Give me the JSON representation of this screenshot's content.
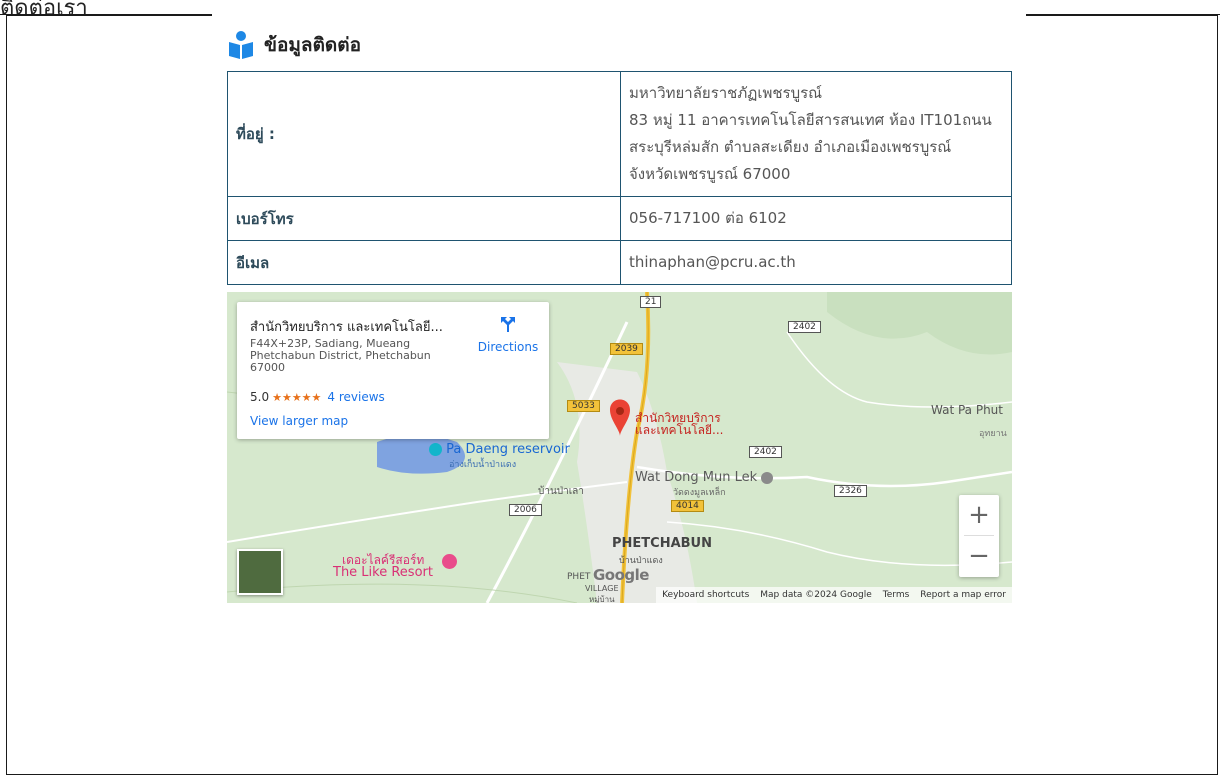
{
  "top_fragment": "ติดต่อเรา",
  "section": {
    "title": "ข้อมูลติดต่อ"
  },
  "contact": {
    "address_label": "ที่อยู่ :",
    "address_lines": [
      "มหาวิทยาลัยราชภัฏเพชรบูรณ์",
      "83 หมู่ 11 อาคารเทคโนโลยีสารสนเทศ ห้อง IT101ถนน",
      "สระบุรีหล่มสัก ตำบลสะเดียง อำเภอเมืองเพชรบูรณ์",
      "จังหวัดเพชรบูรณ์ 67000"
    ],
    "phone_label": "เบอร์โทร",
    "phone_value": "056-717100 ต่อ 6102",
    "email_label": "อีเมล",
    "email_value": "thinaphan@pcru.ac.th"
  },
  "map": {
    "place_card": {
      "title": "สำนักวิทยบริการ และเทคโนโลยี...",
      "address": "F44X+23P, Sadiang, Mueang Phetchabun District, Phetchabun 67000",
      "rating": "5.0",
      "stars": "★★★★★",
      "reviews": "4 reviews",
      "larger_map": "View larger map",
      "directions": "Directions"
    },
    "pin_label_1": "สำนักวิทยบริการ",
    "pin_label_2": "และเทคโนโลยี...",
    "labels": {
      "pa_daeng": "Pa Daeng reservoir",
      "pa_daeng_th": "อ่างเก็บน้ำป่าแดง",
      "wat_dong": "Wat Dong Mun Lek",
      "wat_dong_th": "วัดดงมูลเหล็ก",
      "wat_pa_phut": "Wat Pa Phut",
      "ban_pa_lao": "บ้านป่าเลา",
      "phetchabun": "PHETCHABUN",
      "ban_pa_daeng": "บ้านป่าแดง",
      "phet_village": "PHET",
      "village": "VILLAGE",
      "mu_ban": "หมู่บ้าน",
      "like_resort_th": "เดอะไลค์รีสอร์ท",
      "like_resort": "The Like Resort",
      "u_thong": "อุทยาน"
    },
    "roads": [
      "21",
      "2402",
      "2039",
      "5033",
      "2402",
      "2006",
      "4014",
      "2326"
    ],
    "zoom_in": "+",
    "zoom_out": "−",
    "google": "Google",
    "attribution": {
      "shortcuts": "Keyboard shortcuts",
      "data": "Map data ©2024 Google",
      "terms": "Terms",
      "report": "Report a map error"
    },
    "colors": {
      "pin": "#ea4335",
      "link": "#1a73e8",
      "water": "#7fa3e0",
      "road_major": "#f2c23a"
    }
  }
}
